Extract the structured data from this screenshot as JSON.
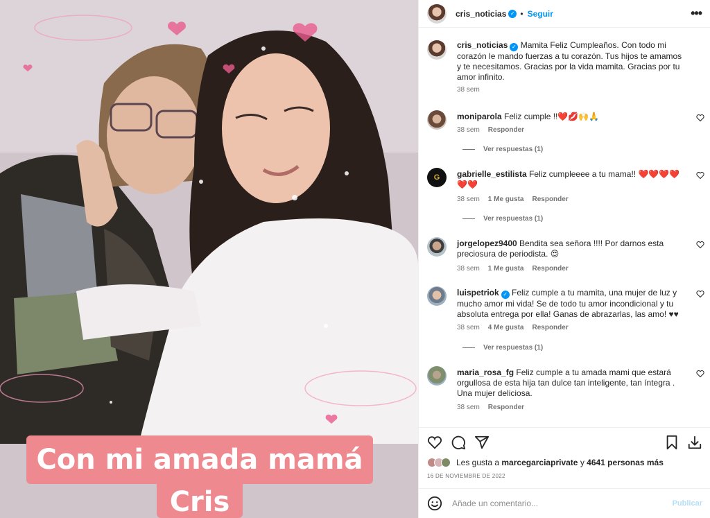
{
  "photo": {
    "caption_line1": "Con mi amada mamá",
    "caption_line2": "Cris"
  },
  "post": {
    "author": "cris_noticias",
    "follow_label": "Seguir",
    "dot": "•",
    "more_label": "•••",
    "caption_text": "Mamita Feliz Cumpleaños. Con todo mi corazón le mando fuerzas a tu corazón. Tus hijos te amamos y te necesitamos. Gracias por la vida mamita. Gracias por tu amor infinito.",
    "caption_time": "38 sem"
  },
  "comments": [
    {
      "user": "moniparola",
      "text": "Feliz cumple !!❤️💋🙌🙏",
      "time": "38 sem",
      "likes": "",
      "reply": "Responder",
      "view_replies": "Ver respuestas (1)"
    },
    {
      "user": "gabrielle_estilista",
      "text": "Feliz cumpleeee a tu mama!! ❤️❤️❤️❤️❤️❤️",
      "time": "38 sem",
      "likes": "1 Me gusta",
      "reply": "Responder",
      "view_replies": "Ver respuestas (1)"
    },
    {
      "user": "jorgelopez9400",
      "text": "Bendita sea señora !!!! Por darnos esta preciosura de periodista. 😍",
      "time": "38 sem",
      "likes": "1 Me gusta",
      "reply": "Responder",
      "view_replies": ""
    },
    {
      "user": "luispetriok",
      "text": "Feliz cumple a tu mamita, una mujer de luz y mucho amor mi vida! Se de todo tu amor incondicional y tu absoluta entrega por ella! Ganas de abrazarlas, las amo! ♥♥",
      "time": "38 sem",
      "likes": "4 Me gusta",
      "reply": "Responder",
      "view_replies": "Ver respuestas (1)"
    },
    {
      "user": "maria_rosa_fg",
      "text": "Feliz cumple a tu amada mami que estará orgullosa de esta hija tan dulce tan inteligente, tan íntegra . Una mujer deliciosa.",
      "time": "38 sem",
      "likes": "",
      "reply": "Responder",
      "view_replies": ""
    }
  ],
  "likes": {
    "prefix": "Les gusta a",
    "user": "marcegarciaprivate",
    "middle": "y",
    "count": "4641 personas más"
  },
  "date": "16 DE NOVIEMBRE DE 2022",
  "add_comment": {
    "placeholder": "Añade un comentario...",
    "publish": "Publicar"
  },
  "icons": {
    "like": "heart-icon",
    "comment": "comment-icon",
    "share": "share-icon",
    "save": "bookmark-icon",
    "download": "download-icon",
    "emoji": "emoji-icon"
  },
  "colors": {
    "accent": "#0095f6",
    "caption_bg": "#ee8a8f",
    "muted": "#737373"
  }
}
